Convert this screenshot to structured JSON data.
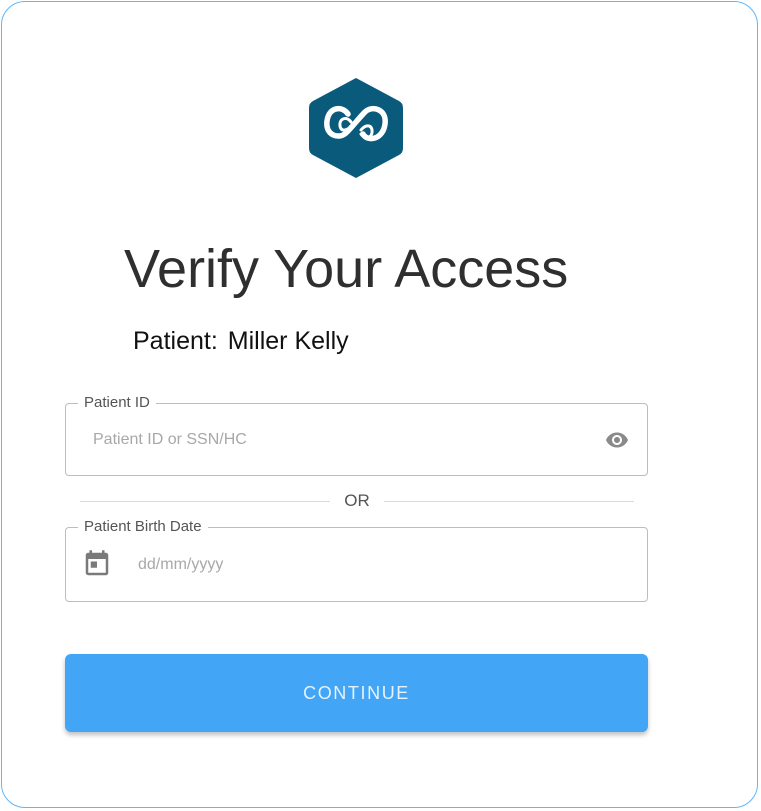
{
  "colors": {
    "accent": "#42a5f5",
    "logo": "#0a5a7c",
    "card_border": "#64b5f6"
  },
  "logo": {
    "icon": "infinity-hexagon-icon"
  },
  "title": "Verify Your Access",
  "patient": {
    "label": "Patient:",
    "name": "Miller Kelly"
  },
  "patient_id_field": {
    "label": "Patient ID",
    "placeholder": "Patient ID or SSN/HC",
    "value": "",
    "icon": "eye-icon"
  },
  "divider": {
    "text": "OR"
  },
  "birth_date_field": {
    "label": "Patient Birth Date",
    "placeholder": "dd/mm/yyyy",
    "value": "",
    "icon": "calendar-icon"
  },
  "continue_button": {
    "label": "CONTINUE"
  }
}
